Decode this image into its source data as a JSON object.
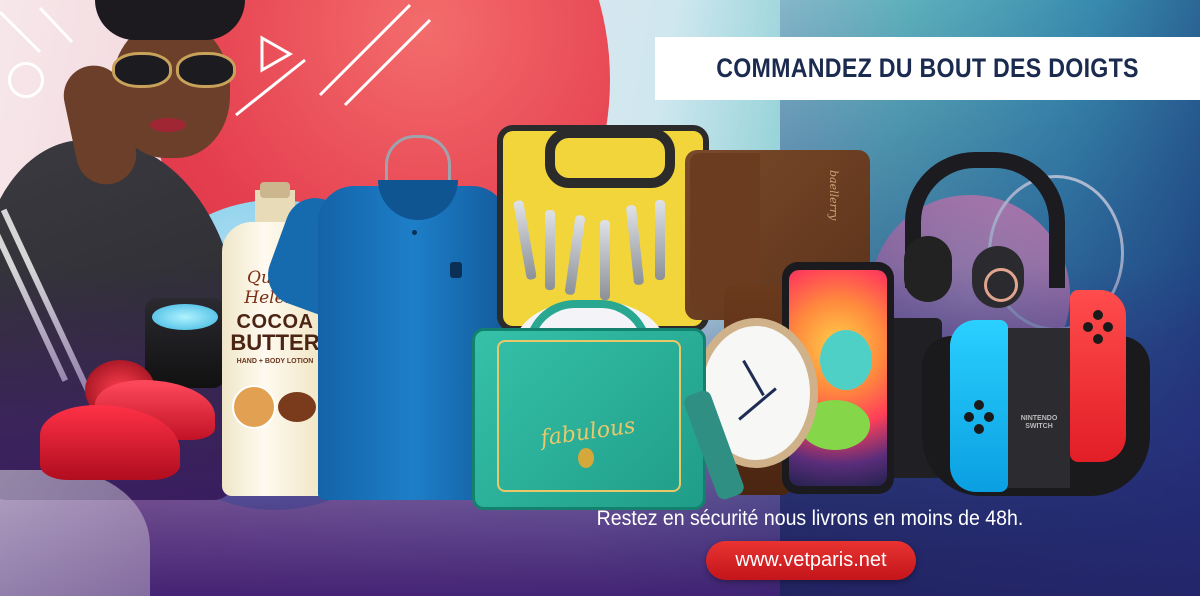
{
  "banner": {
    "headline": "COMMANDEZ DU BOUT DES DOIGTS",
    "tagline": "Restez en sécurité nous livrons en moins de 48h.",
    "url": "www.vetparis.net"
  },
  "products": {
    "lotion": {
      "brand_script": "Queen Helene",
      "line1": "COCOA",
      "line2": "BUTTER",
      "line3": "HAND + BODY LOTION"
    },
    "bag_script": "fabulous",
    "wallet_brand": "baellerry",
    "switch_label_1": "NINTENDO",
    "switch_label_2": "SWITCH"
  },
  "colors": {
    "headline_text": "#1b2a4f",
    "url_pill": "#d7211f",
    "headline_box": "#ffffff"
  },
  "icons": [
    "sunglasses-woman",
    "bluetooth-speaker-icon",
    "red-shoes-icon",
    "lotion-bottle-icon",
    "polo-shirt-icon",
    "toolkit-icon",
    "wallet-icon",
    "handbag-icon",
    "wristwatch-icon",
    "smartphone-icon",
    "headphones-icon",
    "game-console-icon"
  ]
}
